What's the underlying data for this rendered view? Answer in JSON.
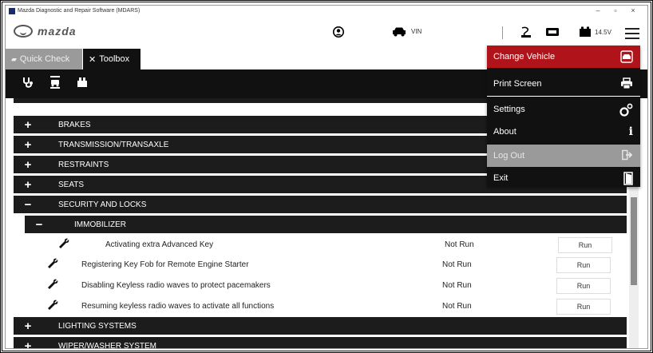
{
  "window": {
    "title": "Mazda Diagnostic and Repair Software (MDARS)",
    "controls": {
      "minimize": "–",
      "maximize": "▫",
      "close": "×"
    }
  },
  "header": {
    "logo_text": "mazda",
    "vin_label": "VIN",
    "voltage": "14.5V"
  },
  "tabs": [
    {
      "label": "Quick Check"
    },
    {
      "label": "Toolbox"
    }
  ],
  "list": {
    "categories": [
      {
        "label": "BRAKES",
        "symbol": "+"
      },
      {
        "label": "TRANSMISSION/TRANSAXLE",
        "symbol": "+"
      },
      {
        "label": "RESTRAINTS",
        "symbol": "+"
      },
      {
        "label": "SEATS",
        "symbol": "+"
      },
      {
        "label": "SECURITY AND LOCKS",
        "symbol": "−"
      }
    ],
    "subcategory": {
      "label": "IMMOBILIZER",
      "symbol": "−"
    },
    "items": [
      {
        "name": "Activating extra Advanced Key",
        "status": "Not Run",
        "action": "Run"
      },
      {
        "name": "Registering Key Fob for Remote Engine Starter",
        "status": "Not Run",
        "action": "Run"
      },
      {
        "name": "Disabling Keyless radio waves to protect pacemakers",
        "status": "Not Run",
        "action": "Run"
      },
      {
        "name": "Resuming keyless radio waves to activate all functions",
        "status": "Not Run",
        "action": "Run"
      }
    ],
    "after": [
      {
        "label": "LIGHTING SYSTEMS",
        "symbol": "+"
      },
      {
        "label": "WIPER/WASHER SYSTEM",
        "symbol": "+"
      }
    ]
  },
  "menu": {
    "items": [
      {
        "label": "Change Vehicle",
        "icon": "car-icon"
      },
      {
        "label": "Print Screen",
        "icon": "printer-icon"
      },
      {
        "label": "Settings",
        "icon": "gears-icon"
      },
      {
        "label": "About",
        "icon": "info-icon"
      },
      {
        "label": "Log Out",
        "icon": "logout-icon"
      },
      {
        "label": "Exit",
        "icon": "exit-door-icon"
      }
    ]
  },
  "colors": {
    "accent_red": "#b0141a",
    "dark": "#111111",
    "disabled_grey": "#9a9a9a"
  }
}
